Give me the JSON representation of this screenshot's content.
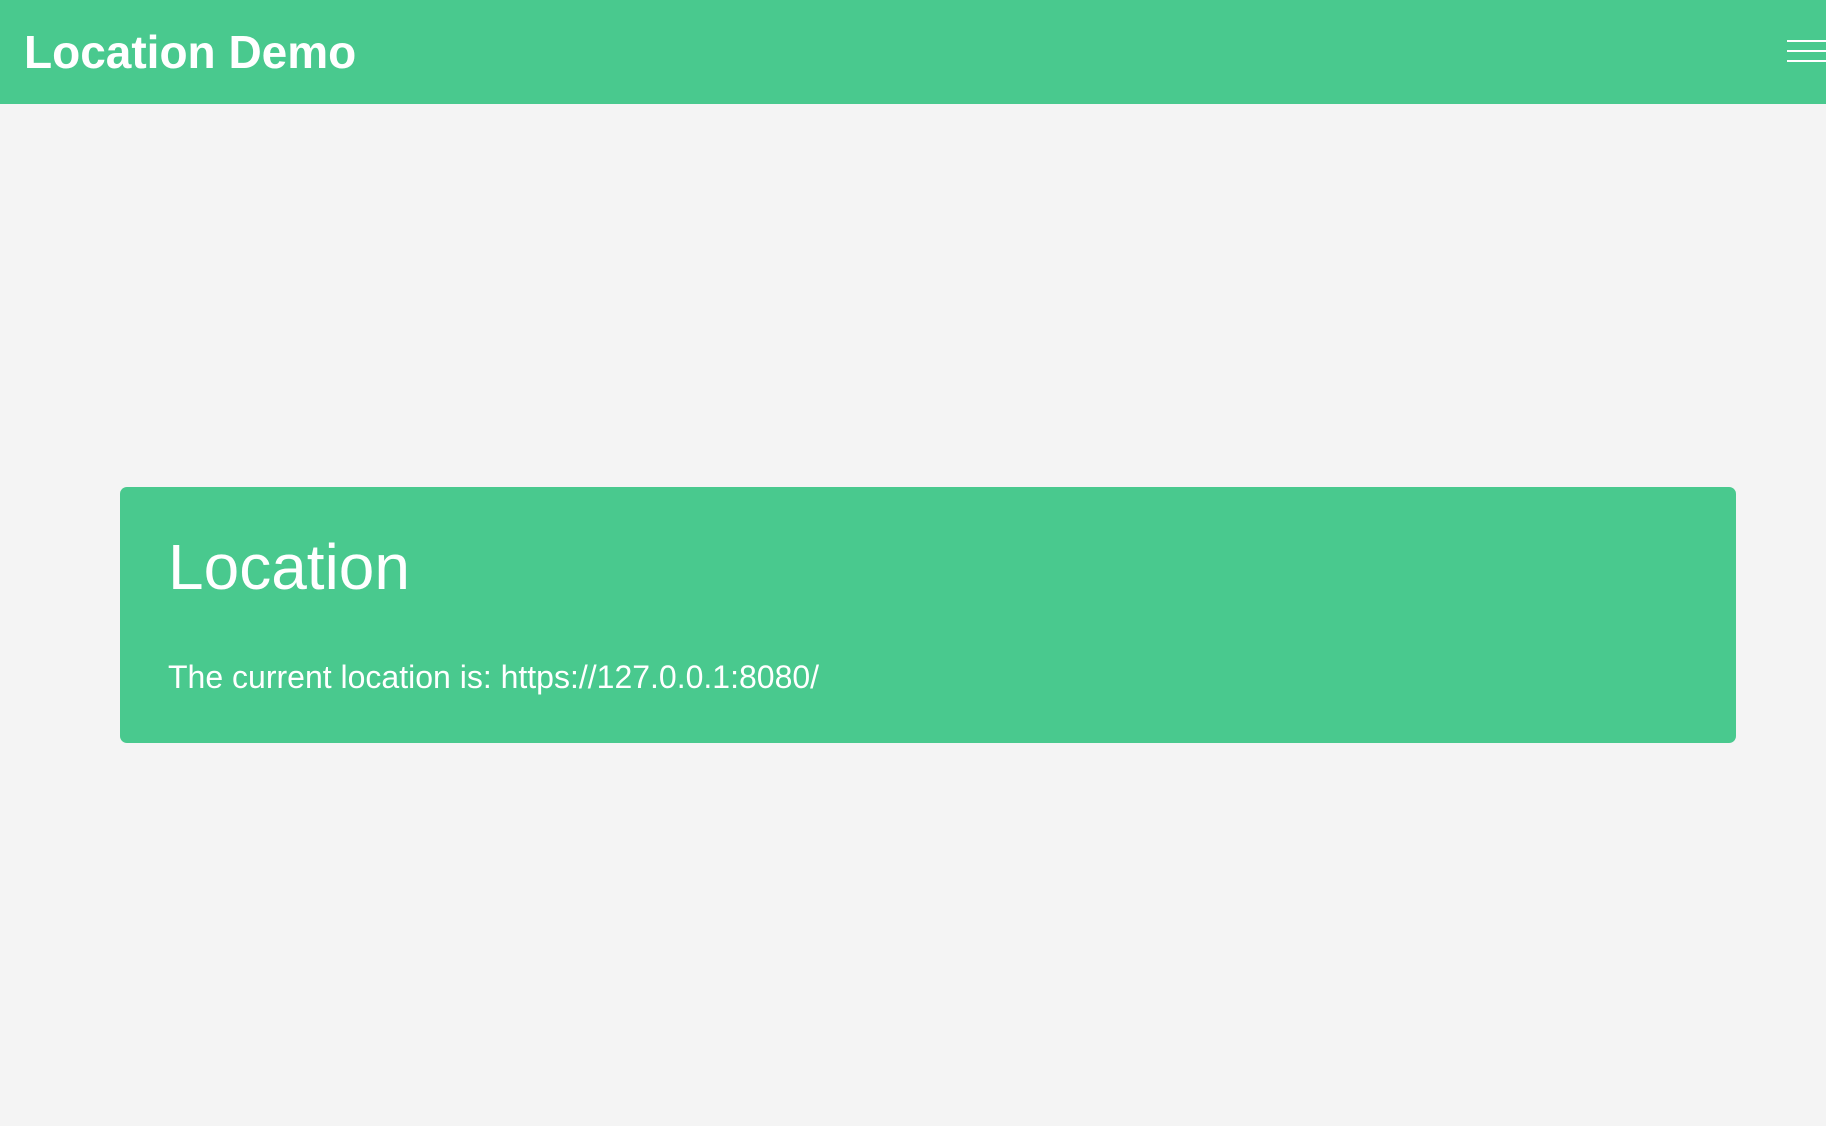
{
  "header": {
    "title": "Location Demo",
    "menu_icon": "hamburger-menu-icon",
    "background_color": "#49c98e"
  },
  "main": {
    "card": {
      "title": "Location",
      "location_text": "The current location is: https://127.0.0.1:8080/",
      "background_color": "#49c98e"
    },
    "page_background_color": "#f4f4f4"
  }
}
